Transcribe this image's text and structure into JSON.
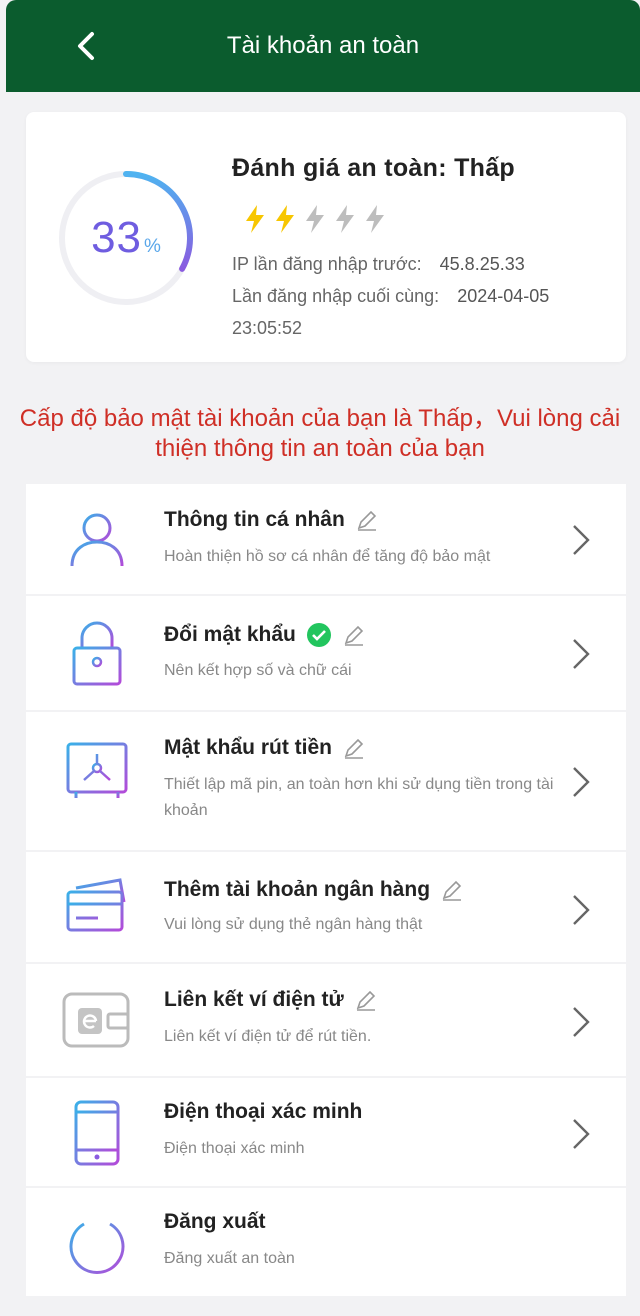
{
  "header": {
    "title": "Tài khoản an toàn"
  },
  "security_card": {
    "percent": "33",
    "percent_unit": "%",
    "score_fraction": 0.33,
    "rating": "Đánh giá an toàn: Thấp",
    "bolts_active": 2,
    "bolts_total": 5,
    "last_ip_label": "IP lần đăng nhập trước:",
    "last_ip_value": "45.8.25.33",
    "last_login_label": "Lần đăng nhập cuối cùng:",
    "last_login_date": "2024-04-05",
    "last_login_time": "23:05:52"
  },
  "warning": "Cấp độ bảo mật tài khoản của bạn là Thấp，Vui lòng cải thiện thông tin an toàn của bạn",
  "items": [
    {
      "title": "Thông tin cá nhân",
      "desc": "Hoàn thiện hồ sơ cá nhân để tăng độ bảo mật",
      "icon": "user-icon"
    },
    {
      "title": "Đổi mật khẩu",
      "desc": "Nên kết hợp số và chữ cái",
      "icon": "lock-icon"
    },
    {
      "title": "Mật khẩu rút tiền",
      "desc": "Thiết lập mã pin, an toàn hơn khi sử dụng tiền trong tài khoản",
      "icon": "safe-icon"
    },
    {
      "title": "Thêm tài khoản ngân hàng",
      "desc": "Vui lòng sử dụng thẻ ngân hàng thật",
      "icon": "bank-card-icon"
    },
    {
      "title": "Liên kết ví điện tử",
      "desc": "Liên kết ví điện tử để rút tiền.",
      "icon": "e-wallet-icon"
    },
    {
      "title": "Điện thoại xác minh",
      "desc": "Điện thoại xác minh",
      "icon": "phone-icon"
    },
    {
      "title": "Đăng xuất",
      "desc": "Đăng xuất an toàn",
      "icon": "power-icon"
    }
  ],
  "colors": {
    "header": "#0b5c2e",
    "warning": "#cf2f26",
    "bolt_active": "#f7c600",
    "bolt_inactive": "#bdbdbd",
    "check": "#22c55e",
    "gauge": "#5aa7ea"
  }
}
